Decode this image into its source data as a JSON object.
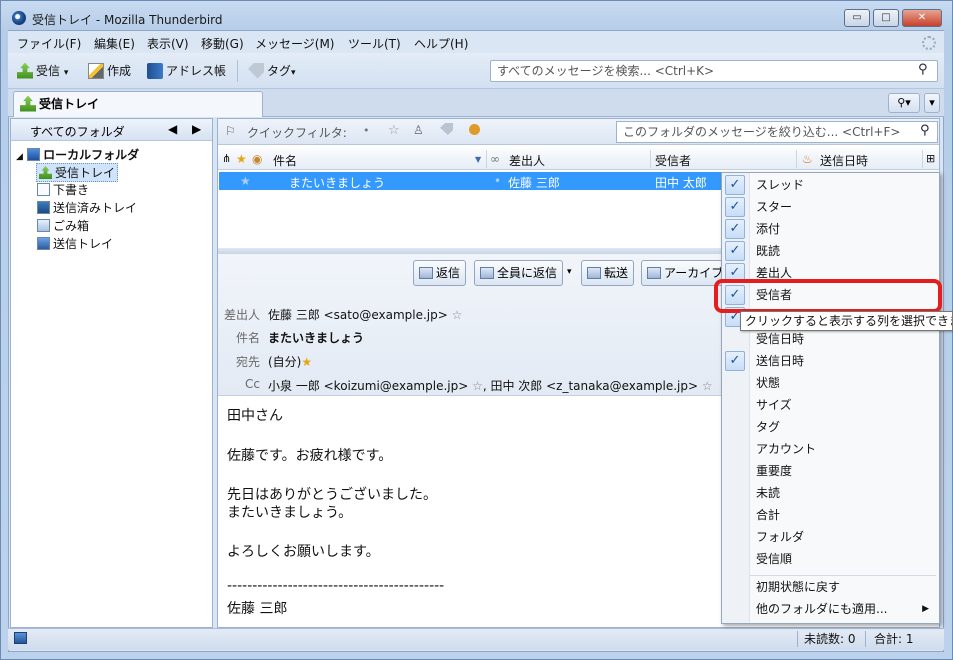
{
  "window": {
    "title": "受信トレイ - Mozilla Thunderbird",
    "minimize": "▭",
    "maximize": "□",
    "close": "✕"
  },
  "menubar": [
    "ファイル(F)",
    "編集(E)",
    "表示(V)",
    "移動(G)",
    "メッセージ(M)",
    "ツール(T)",
    "ヘルプ(H)"
  ],
  "toolbar": {
    "get_mail": "受信",
    "write": "作成",
    "address_book": "アドレス帳",
    "tag": "タグ",
    "search_placeholder": "すべてのメッセージを検索... <Ctrl+K>"
  },
  "tab": {
    "label": "受信トレイ"
  },
  "folder_pane": {
    "header": "すべてのフォルダ",
    "account": "ローカルフォルダ",
    "folders": [
      "受信トレイ",
      "下書き",
      "送信済みトレイ",
      "ごみ箱",
      "送信トレイ"
    ]
  },
  "quick_filter": {
    "label": "クイックフィルタ:",
    "search_placeholder": "このフォルダのメッセージを絞り込む... <Ctrl+F>"
  },
  "columns": {
    "subject": "件名",
    "sender": "差出人",
    "recipient": "受信者",
    "date": "送信日時"
  },
  "message_row": {
    "subject": "またいきましょう",
    "sender": "佐藤 三郎",
    "recipient": "田中 太郎"
  },
  "header_actions": {
    "reply": "返信",
    "reply_all": "全員に返信",
    "forward": "転送",
    "archive": "アーカイブ"
  },
  "message_header": {
    "from_label": "差出人",
    "from_value": "佐藤 三郎 <sato@example.jp>",
    "subject_label": "件名",
    "subject_value": "またいきましょう",
    "to_label": "宛先",
    "to_value": "(自分)",
    "cc_label": "Cc",
    "cc_value1": "小泉 一郎 <koizumi@example.jp>",
    "cc_value2": ", 田中 次郎 <z_tanaka@example.jp>"
  },
  "body_lines": [
    "田中さん",
    "佐藤です。お疲れ様です。",
    "先日はありがとうございました。",
    "またいきましょう。",
    "よろしくお願いします。",
    "-------------------------------------------",
    "佐藤 三郎"
  ],
  "status": {
    "unread": "未読数: 0",
    "total": "合計: 1"
  },
  "column_picker": {
    "items": [
      {
        "label": "スレッド",
        "checked": true
      },
      {
        "label": "スター",
        "checked": true
      },
      {
        "label": "添付",
        "checked": true
      },
      {
        "label": "既読",
        "checked": true
      },
      {
        "label": "差出人",
        "checked": true
      },
      {
        "label": "受信者",
        "checked": true
      },
      {
        "label": "受信日時",
        "checked": true
      },
      {
        "label": "受信日時",
        "checked": false
      },
      {
        "label": "送信日時",
        "checked": true
      },
      {
        "label": "状態",
        "checked": false
      },
      {
        "label": "サイズ",
        "checked": false
      },
      {
        "label": "タグ",
        "checked": false
      },
      {
        "label": "アカウント",
        "checked": false
      },
      {
        "label": "重要度",
        "checked": false
      },
      {
        "label": "未読",
        "checked": false
      },
      {
        "label": "合計",
        "checked": false
      },
      {
        "label": "フォルダ",
        "checked": false
      },
      {
        "label": "受信順",
        "checked": false
      }
    ],
    "reset": "初期状態に戻す",
    "apply_other": "他のフォルダにも適用...",
    "check_mark": "✓",
    "submenu_arrow": "▶"
  },
  "tooltip": "クリックすると表示する列を選択できます",
  "accent_colors": {
    "selection": "#3399ff",
    "highlight": "#e61d1d"
  }
}
